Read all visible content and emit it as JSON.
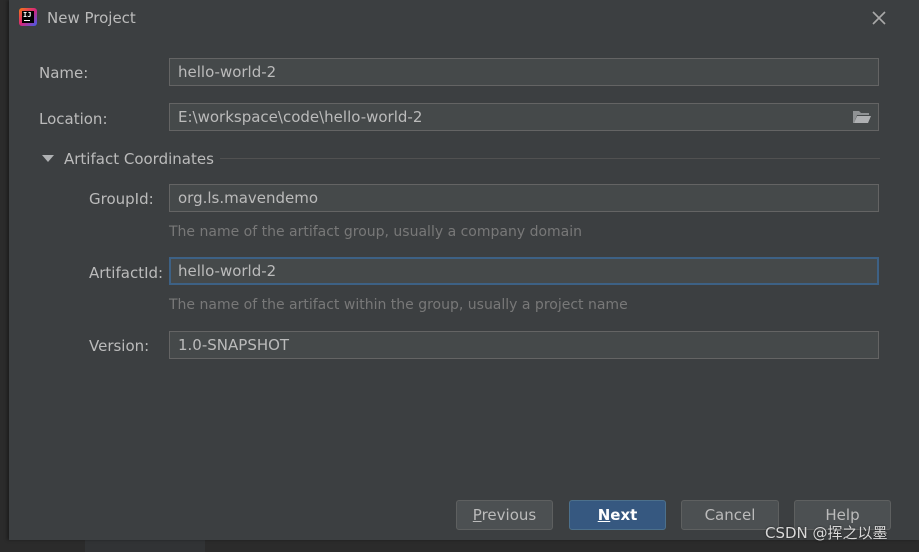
{
  "window": {
    "title": "New Project"
  },
  "form": {
    "name_label": "Name:",
    "name_value": "hello-world-2",
    "location_label": "Location:",
    "location_value": "E:\\workspace\\code\\hello-world-2"
  },
  "artifact": {
    "section_label": "Artifact Coordinates",
    "groupid_label": "GroupId:",
    "groupid_value": "org.ls.mavendemo",
    "groupid_hint": "The name of the artifact group, usually a company domain",
    "artifactid_label": "ArtifactId:",
    "artifactid_value": "hello-world-2",
    "artifactid_hint": "The name of the artifact within the group, usually a project name",
    "version_label": "Version:",
    "version_value": "1.0-SNAPSHOT"
  },
  "buttons": {
    "previous_mnemonic": "P",
    "previous_rest": "revious",
    "next_mnemonic": "N",
    "next_rest": "ext",
    "cancel": "Cancel",
    "help": "Help"
  },
  "watermark": "CSDN @挥之以墨",
  "colors": {
    "dialog_bg": "#3c3f41",
    "field_bg": "#45494a",
    "primary_button": "#365880",
    "focus_border": "#3d6185",
    "hint_text": "#787878"
  },
  "icons": {
    "app": "intellij-idea-icon",
    "close": "close-icon",
    "browse": "folder-open-icon",
    "expand": "triangle-down-icon"
  }
}
